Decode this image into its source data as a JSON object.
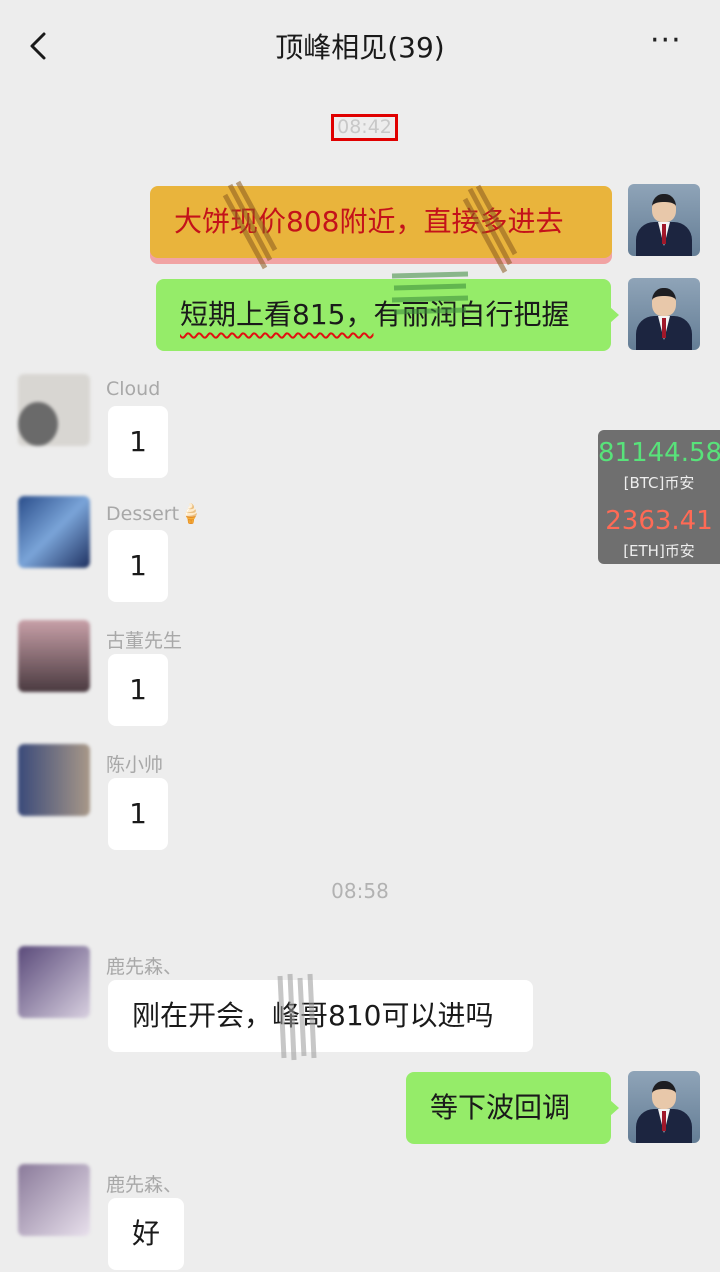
{
  "header": {
    "title": "顶峰相见(39)",
    "back_icon": "chevron-left-icon",
    "more_icon": "more-horizontal-icon",
    "more_label": "···"
  },
  "timestamps": [
    "08:42",
    "08:58"
  ],
  "messages": [
    {
      "side": "out",
      "text": "大饼现价808附近，直接多进去",
      "highlighted": true
    },
    {
      "side": "out",
      "text_a": "短期上看815，",
      "text_b": "有丽润自行把握"
    },
    {
      "side": "in",
      "sender": "Cloud",
      "text": "1"
    },
    {
      "side": "in",
      "sender": "Dessert🍦",
      "text": "1"
    },
    {
      "side": "in",
      "sender": "古董先生",
      "text": "1"
    },
    {
      "side": "in",
      "sender": "陈小帅",
      "text": "1"
    },
    {
      "side": "in",
      "sender": "鹿先森、",
      "text": "刚在开会，峰哥810可以进吗"
    },
    {
      "side": "out",
      "text": "等下波回调"
    },
    {
      "side": "in",
      "sender": "鹿先森、",
      "text": "好"
    }
  ],
  "ticker": {
    "btc_price": "81144.58",
    "btc_label": "[BTC]币安",
    "eth_price": "2363.41",
    "eth_label": "[ETH]币安",
    "colors": {
      "btc": "#58e27a",
      "eth": "#ff6a55"
    }
  },
  "colors": {
    "background": "#ededed",
    "outgoing_bubble": "#95ec69",
    "incoming_bubble": "#ffffff",
    "highlight_bubble": "#e9b43c",
    "highlight_text": "#c4121a"
  }
}
